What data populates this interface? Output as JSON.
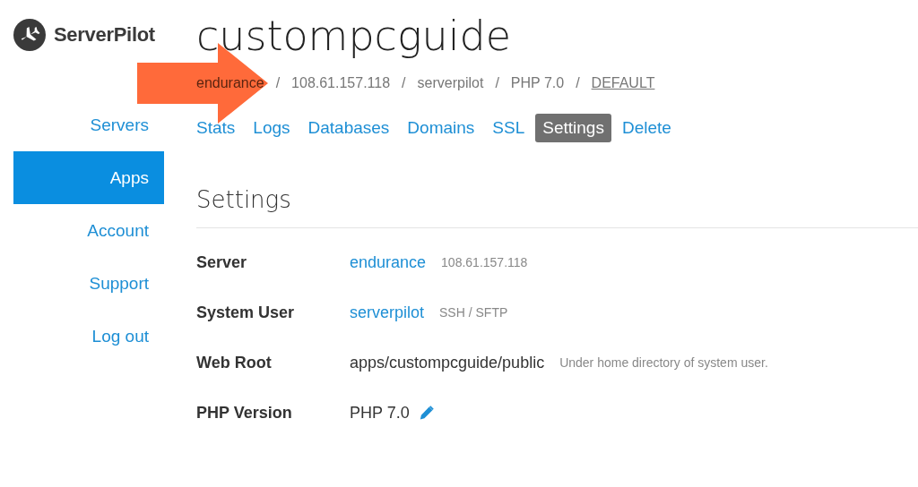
{
  "logo": {
    "text": "ServerPilot"
  },
  "sidebar": {
    "items": [
      {
        "label": "Servers",
        "selected": false
      },
      {
        "label": "Apps",
        "selected": true
      },
      {
        "label": "Account",
        "selected": false
      },
      {
        "label": "Support",
        "selected": false
      },
      {
        "label": "Log out",
        "selected": false
      }
    ]
  },
  "app": {
    "title": "custompcguide",
    "breadcrumb": [
      {
        "label": "endurance",
        "kind": "faded"
      },
      {
        "label": "108.61.157.118",
        "kind": "text"
      },
      {
        "label": "serverpilot",
        "kind": "text"
      },
      {
        "label": "PHP 7.0",
        "kind": "text"
      },
      {
        "label": "DEFAULT",
        "kind": "link"
      }
    ],
    "separator": "/",
    "tabs": [
      {
        "label": "Stats",
        "selected": false
      },
      {
        "label": "Logs",
        "selected": false
      },
      {
        "label": "Databases",
        "selected": false
      },
      {
        "label": "Domains",
        "selected": false
      },
      {
        "label": "SSL",
        "selected": false
      },
      {
        "label": "Settings",
        "selected": true
      },
      {
        "label": "Delete",
        "selected": false
      }
    ]
  },
  "settings": {
    "heading": "Settings",
    "rows": [
      {
        "label": "Server",
        "value": "endurance",
        "kind": "link",
        "note": "108.61.157.118",
        "editable": false
      },
      {
        "label": "System User",
        "value": "serverpilot",
        "kind": "link",
        "note": "SSH / SFTP",
        "editable": false
      },
      {
        "label": "Web Root",
        "value": "apps/custompcguide/public",
        "kind": "text",
        "note": "Under home directory of system user.",
        "editable": false
      },
      {
        "label": "PHP Version",
        "value": "PHP 7.0",
        "kind": "text",
        "editable": true
      }
    ]
  }
}
